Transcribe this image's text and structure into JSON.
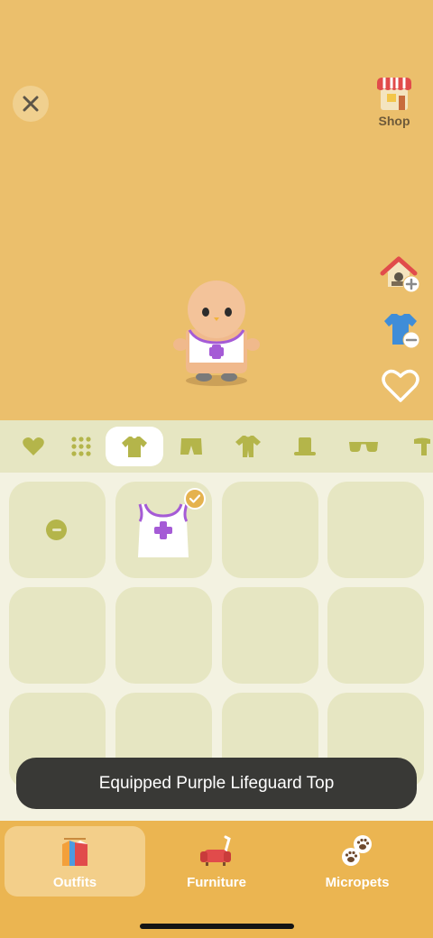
{
  "header": {
    "shop_label": "Shop"
  },
  "side_actions": [
    "home-add-icon",
    "shirt-remove-icon",
    "heart-icon"
  ],
  "category_tabs": [
    {
      "name": "favorites",
      "icon": "heart-icon",
      "active": false
    },
    {
      "name": "all",
      "icon": "grid-icon",
      "active": false
    },
    {
      "name": "tops",
      "icon": "shirt-icon",
      "active": true
    },
    {
      "name": "bottoms",
      "icon": "shorts-icon",
      "active": false
    },
    {
      "name": "full-body",
      "icon": "jumpsuit-icon",
      "active": false
    },
    {
      "name": "hats",
      "icon": "top-hat-icon",
      "active": false
    },
    {
      "name": "glasses",
      "icon": "sunglasses-icon",
      "active": false
    },
    {
      "name": "scarves",
      "icon": "scarf-icon",
      "active": false
    }
  ],
  "items": {
    "equipped_item": "Purple Lifeguard Top"
  },
  "toast": {
    "message": "Equipped Purple Lifeguard Top"
  },
  "bottom_nav": {
    "items": [
      {
        "label": "Outfits",
        "active": true
      },
      {
        "label": "Furniture",
        "active": false
      },
      {
        "label": "Micropets",
        "active": false
      }
    ]
  },
  "colors": {
    "stage_bg": "#ebbf6c",
    "tab_bar_bg": "#e6e6c2",
    "grid_bg": "#f3f2e1",
    "accent_olive": "#b4b54a",
    "bottom_nav_bg": "#ebb551",
    "toast_bg": "#393936"
  }
}
